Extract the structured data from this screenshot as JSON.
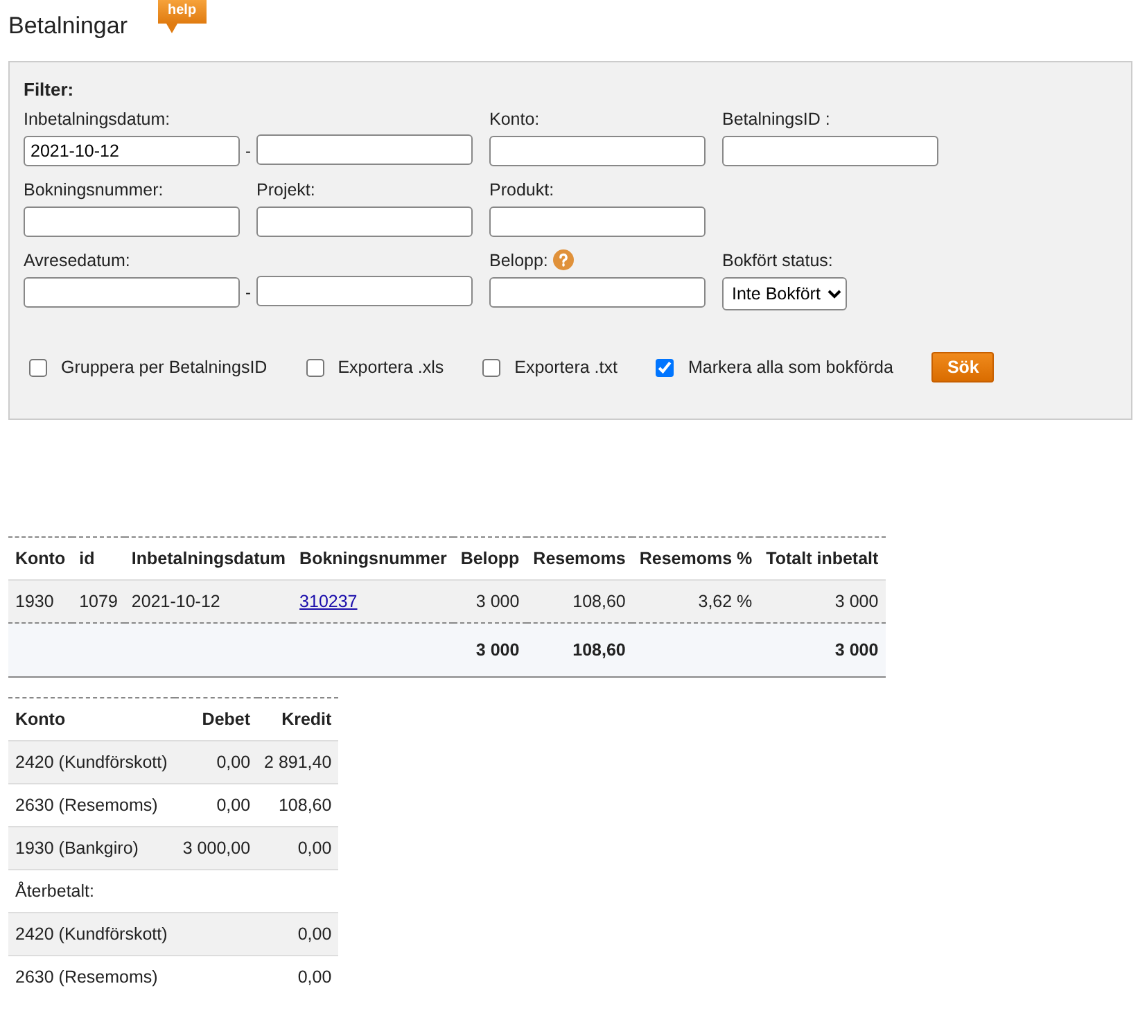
{
  "page": {
    "title": "Betalningar",
    "help_label": "help"
  },
  "filter": {
    "title": "Filter:",
    "rows": [
      [
        {
          "kind": "date_from",
          "label": "Inbetalningsdatum:",
          "value": "2021-10-12",
          "separator": "-"
        },
        {
          "kind": "date_to"
        },
        {
          "kind": "text",
          "label": "Konto:"
        },
        {
          "kind": "text",
          "label": "BetalningsID :"
        }
      ],
      [
        {
          "kind": "text",
          "label": "Bokningsnummer:"
        },
        {
          "kind": "text",
          "label": "Projekt:"
        },
        {
          "kind": "text",
          "label": "Produkt:"
        }
      ],
      [
        {
          "kind": "date_from",
          "label": "Avresedatum:",
          "separator": "-"
        },
        {
          "kind": "date_to"
        },
        {
          "kind": "text",
          "label": "Belopp:",
          "help": true
        },
        {
          "kind": "select",
          "label": "Bokfört status:",
          "value": "Inte Bokfört"
        }
      ]
    ],
    "options": [
      {
        "label": "Gruppera per BetalningsID",
        "checked": false
      },
      {
        "label": "Exportera .xls",
        "checked": false
      },
      {
        "label": "Exportera .txt",
        "checked": false
      },
      {
        "label": "Markera alla som bokförda",
        "checked": true
      }
    ],
    "search_button": "Sök"
  },
  "payments": {
    "columns": [
      {
        "label": "Konto",
        "kind": "text"
      },
      {
        "label": "id",
        "kind": "text"
      },
      {
        "label": "Inbetalningsdatum",
        "kind": "text"
      },
      {
        "label": "Bokningsnummer",
        "kind": "link"
      },
      {
        "label": "Belopp",
        "kind": "number"
      },
      {
        "label": "Resemoms",
        "kind": "number"
      },
      {
        "label": "Resemoms %",
        "kind": "number"
      },
      {
        "label": "Totalt inbetalt",
        "kind": "number"
      }
    ],
    "rows": [
      [
        "1930",
        "1079",
        "2021-10-12",
        "310237",
        "3 000",
        "108,60",
        "3,62 %",
        "3 000"
      ]
    ],
    "totals": {
      "4": "3 000",
      "5": "108,60",
      "7": "3 000"
    }
  },
  "ledger": {
    "columns": [
      "Konto",
      "Debet",
      "Kredit"
    ],
    "rows": [
      {
        "kind": "entry",
        "account": "2420 (Kundförskott)",
        "debet": "0,00",
        "kredit": "2 891,40"
      },
      {
        "kind": "entry",
        "account": "2630 (Resemoms)",
        "debet": "0,00",
        "kredit": "108,60"
      },
      {
        "kind": "entry",
        "account": "1930 (Bankgiro)",
        "debet": "3 000,00",
        "kredit": "0,00"
      },
      {
        "kind": "section",
        "account": "Återbetalt:"
      },
      {
        "kind": "entry",
        "account": "2420 (Kundförskott)",
        "kredit": "0,00"
      },
      {
        "kind": "entry",
        "account": "2630 (Resemoms)",
        "kredit": "0,00"
      }
    ]
  }
}
